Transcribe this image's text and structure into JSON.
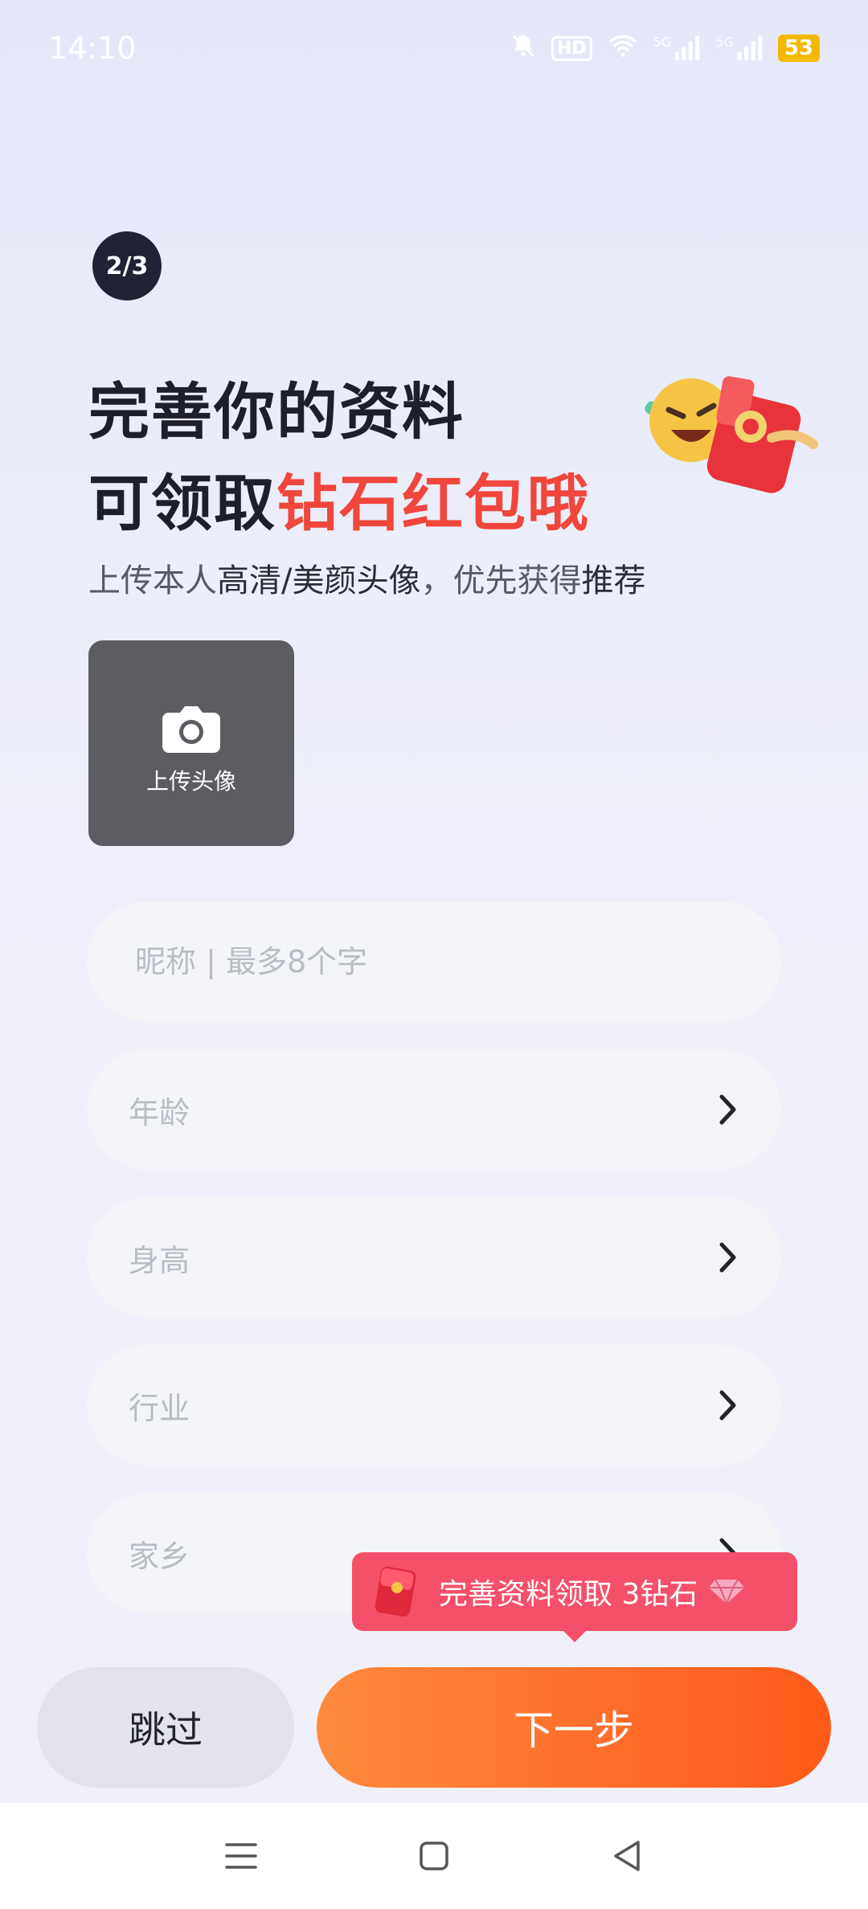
{
  "status_bar": {
    "time": "14:10",
    "hd_label": "HD",
    "signal1_label": "5G",
    "signal2_label": "5G",
    "battery": "53"
  },
  "step": "2/3",
  "headline": {
    "line1": "完善你的资料",
    "line2_prefix": "可领取",
    "line2_accent": "钻石红包哦"
  },
  "subtitle": {
    "part1": "上传本人",
    "part2": "高清/美颜头像",
    "part3": "，优先获得",
    "part4": "推荐"
  },
  "avatar_upload": {
    "label": "上传头像"
  },
  "fields": {
    "nickname_placeholder": "昵称 | 最多8个字",
    "age_label": "年龄",
    "height_label": "身高",
    "industry_label": "行业",
    "hometown_label": "家乡"
  },
  "toast": {
    "text": "完善资料领取 3钻石"
  },
  "buttons": {
    "skip": "跳过",
    "next": "下一步"
  },
  "colors": {
    "accent_red": "#f0463c",
    "next_orange": "#ff6e2a",
    "toast_pink": "#f5506a",
    "step_badge": "#1f2333"
  },
  "icons": {
    "camera": "camera-icon",
    "chevron": "chevron-right-icon",
    "nav_menu": "menu-icon",
    "nav_home": "home-square-icon",
    "nav_back": "back-triangle-icon"
  }
}
